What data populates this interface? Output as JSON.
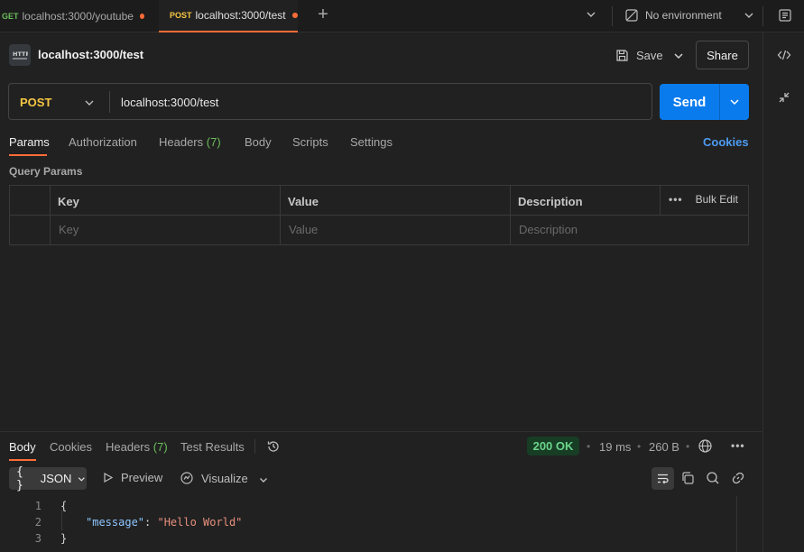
{
  "tabs": [
    {
      "method": "GET",
      "label": "localhost:3000/youtube"
    },
    {
      "method": "POST",
      "label": "localhost:3000/test"
    }
  ],
  "environment": {
    "label": "No environment"
  },
  "request": {
    "title": "localhost:3000/test",
    "method": "POST",
    "url": "localhost:3000/test",
    "save_label": "Save",
    "share_label": "Share",
    "send_label": "Send"
  },
  "request_tabs": {
    "params": "Params",
    "authorization": "Authorization",
    "headers": "Headers",
    "headers_count": "(7)",
    "body": "Body",
    "scripts": "Scripts",
    "settings": "Settings",
    "cookies": "Cookies"
  },
  "query_params": {
    "title": "Query Params",
    "columns": [
      "Key",
      "Value",
      "Description"
    ],
    "placeholders": [
      "Key",
      "Value",
      "Description"
    ],
    "bulk_edit": "Bulk Edit"
  },
  "response": {
    "tabs": {
      "body": "Body",
      "cookies": "Cookies",
      "headers": "Headers",
      "headers_count": "(7)",
      "test_results": "Test Results"
    },
    "status": "200 OK",
    "time": "19 ms",
    "size": "260 B",
    "format": "JSON",
    "preview": "Preview",
    "visualize": "Visualize",
    "lines": [
      {
        "n": "1",
        "open": "{"
      },
      {
        "n": "2",
        "key": "\"message\"",
        "sep": ": ",
        "value": "\"Hello World\""
      },
      {
        "n": "3",
        "close": "}"
      }
    ]
  },
  "colors": {
    "accent": "#ff6c37",
    "send": "#097bed",
    "post_method": "#f7c744",
    "get_method": "#6bbd5b",
    "status_ok": "#6bd48b"
  }
}
